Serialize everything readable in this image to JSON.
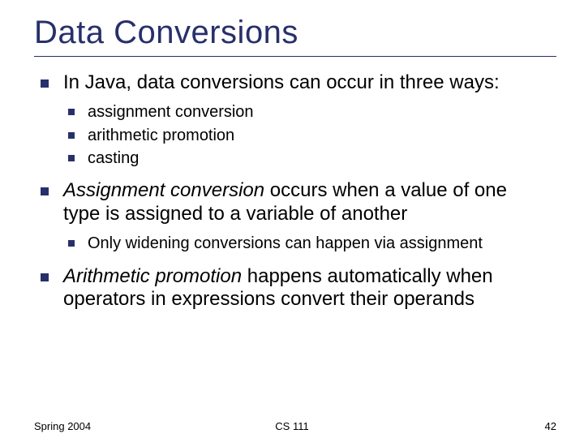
{
  "title": "Data Conversions",
  "bullets": {
    "b1": {
      "text": "In Java, data conversions can occur in three ways:",
      "sub": [
        "assignment conversion",
        "arithmetic promotion",
        "casting"
      ]
    },
    "b2": {
      "em": "Assignment conversion",
      "rest": " occurs when a value of one type is assigned to a variable of another",
      "sub": [
        "Only widening conversions can happen via assignment"
      ]
    },
    "b3": {
      "em": "Arithmetic promotion",
      "rest": " happens automatically when operators in expressions convert their operands"
    }
  },
  "footer": {
    "left": "Spring 2004",
    "center": "CS 111",
    "right": "42"
  }
}
